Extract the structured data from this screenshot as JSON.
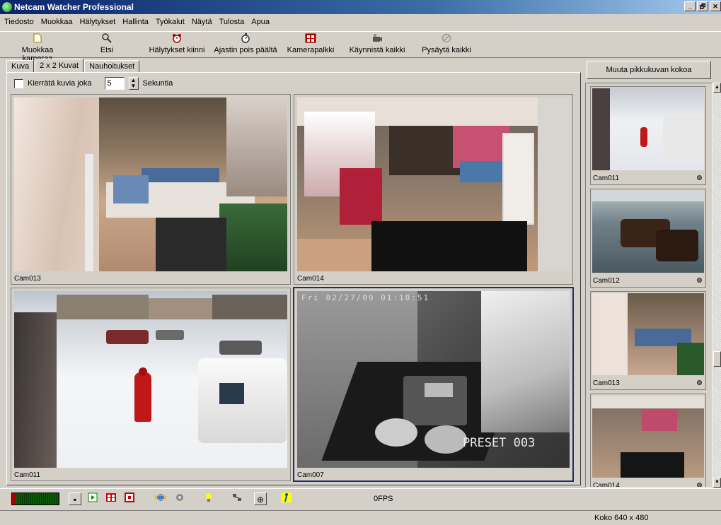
{
  "window": {
    "title": "Netcam Watcher Professional",
    "controls": [
      "_",
      "🗗",
      "✕"
    ]
  },
  "menu": [
    "Tiedosto",
    "Muokkaa",
    "Hälytykset",
    "Hallinta",
    "Työkalut",
    "Näytä",
    "Tulosta",
    "Apua"
  ],
  "toolbar": [
    {
      "label": "Muokkaa kameraa",
      "icon": "page-icon"
    },
    {
      "label": "Etsi",
      "icon": "magnifier-icon"
    },
    {
      "label": "Hälytykset kiinni",
      "icon": "alarm-clock-icon"
    },
    {
      "label": "Ajastin pois päältä",
      "icon": "timer-icon"
    },
    {
      "label": "Kamerapalkki",
      "icon": "camera-bar-icon"
    },
    {
      "label": "Käynnistä kaikki",
      "icon": "camera-start-icon"
    },
    {
      "label": "Pysäytä kaikki",
      "icon": "stop-icon"
    }
  ],
  "tabs": [
    "Kuva",
    "2 x 2 Kuvat",
    "Nauhoitukset"
  ],
  "active_tab": "2 x 2 Kuvat",
  "rotate": {
    "label": "Kierrätä kuvia joka",
    "value": "5",
    "unit": "Sekuntia",
    "checked": false
  },
  "grid": [
    {
      "name": "Cam013"
    },
    {
      "name": "Cam014"
    },
    {
      "name": "Cam011"
    },
    {
      "name": "Cam007",
      "overlay_top": "Fri 02/27/09 01:10:51",
      "overlay_bottom": "PRESET 003",
      "selected": true
    }
  ],
  "resize_button": "Muuta pikkukuvan kokoa",
  "thumbnails": [
    "Cam011",
    "Cam012",
    "Cam013",
    "Cam014"
  ],
  "status": {
    "fps": "0FPS",
    "size": "Koko 640 x 480"
  },
  "colors": {
    "title_bar": "#0a246a",
    "selected_border": "#1c2c6c",
    "face": "#d4d0c8"
  }
}
